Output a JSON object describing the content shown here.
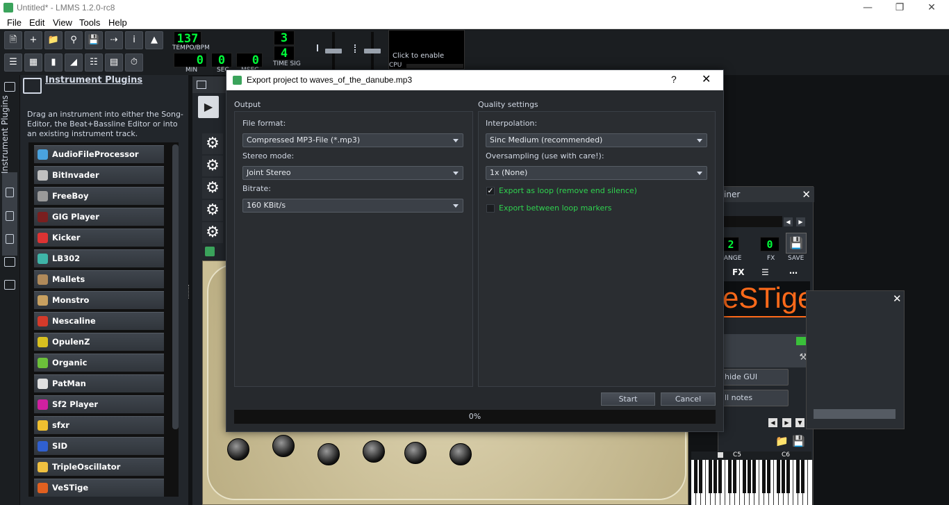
{
  "window": {
    "title": "Untitled* - LMMS 1.2.0-rc8"
  },
  "menu": [
    "File",
    "Edit",
    "View",
    "Tools",
    "Help"
  ],
  "toolbar": {
    "tempo_value": "137",
    "tempo_label": "TEMPO/BPM",
    "min_value": "0",
    "sec_value": "0",
    "msec_value": "0",
    "min_label": "MIN",
    "sec_label": "SEC",
    "msec_label": "MSEC",
    "timesig_num": "3",
    "timesig_den": "4",
    "timesig_label": "TIME SIG",
    "cpu_hint": "Click to enable",
    "cpu_label": "CPU"
  },
  "sidebar": {
    "active_tab": "Instrument Plugins"
  },
  "plugin_panel": {
    "title": "Instrument Plugins",
    "description": "Drag an instrument into either the Song-Editor, the Beat+Bassline Editor or into an existing instrument track.",
    "items": [
      {
        "label": "AudioFileProcessor",
        "color": "#4aa3df"
      },
      {
        "label": "BitInvader",
        "color": "#c0c0c0"
      },
      {
        "label": "FreeBoy",
        "color": "#9a9a9a"
      },
      {
        "label": "GIG Player",
        "color": "#7a1f1f"
      },
      {
        "label": "Kicker",
        "color": "#d33"
      },
      {
        "label": "LB302",
        "color": "#3fb5a8"
      },
      {
        "label": "Mallets",
        "color": "#b08a5a"
      },
      {
        "label": "Monstro",
        "color": "#c8a060"
      },
      {
        "label": "Nescaline",
        "color": "#d43a2a"
      },
      {
        "label": "OpulenZ",
        "color": "#d8c020"
      },
      {
        "label": "Organic",
        "color": "#6cc03a"
      },
      {
        "label": "PatMan",
        "color": "#e0e0e0"
      },
      {
        "label": "Sf2 Player",
        "color": "#d020a0"
      },
      {
        "label": "sfxr",
        "color": "#f0c030"
      },
      {
        "label": "SID",
        "color": "#3060d0"
      },
      {
        "label": "TripleOscillator",
        "color": "#f0c040"
      },
      {
        "label": "VeSTige",
        "color": "#e06020"
      }
    ]
  },
  "dialog": {
    "title": "Export project to waves_of_the_danube.mp3",
    "help": "?",
    "output": {
      "group_title": "Output",
      "file_format_label": "File format:",
      "file_format_value": "Compressed MP3-File (*.mp3)",
      "stereo_mode_label": "Stereo mode:",
      "stereo_mode_value": "Joint Stereo",
      "bitrate_label": "Bitrate:",
      "bitrate_value": "160 KBit/s"
    },
    "quality": {
      "group_title": "Quality settings",
      "interpolation_label": "Interpolation:",
      "interpolation_value": "Sinc Medium (recommended)",
      "oversampling_label": "Oversampling (use with care!):",
      "oversampling_value": "1x (None)",
      "export_loop_label": "Export as loop (remove end silence)",
      "export_loop_checked": true,
      "export_markers_label": "Export between loop markers",
      "export_markers_checked": false
    },
    "start_label": "Start",
    "cancel_label": "Cancel",
    "progress_text": "0%",
    "progress": 0
  },
  "right_window": {
    "title_fragment": "iner",
    "range_label": "RANGE",
    "range_value": "2",
    "fx_label": "FX",
    "fx_value": "0",
    "save_label": "SAVE",
    "tab_fx": "FX",
    "logo_text": "eSTige",
    "hide_gui_label": "hide GUI",
    "all_notes_label": "ll notes",
    "key_c5": "C5",
    "key_c6": "C6"
  }
}
